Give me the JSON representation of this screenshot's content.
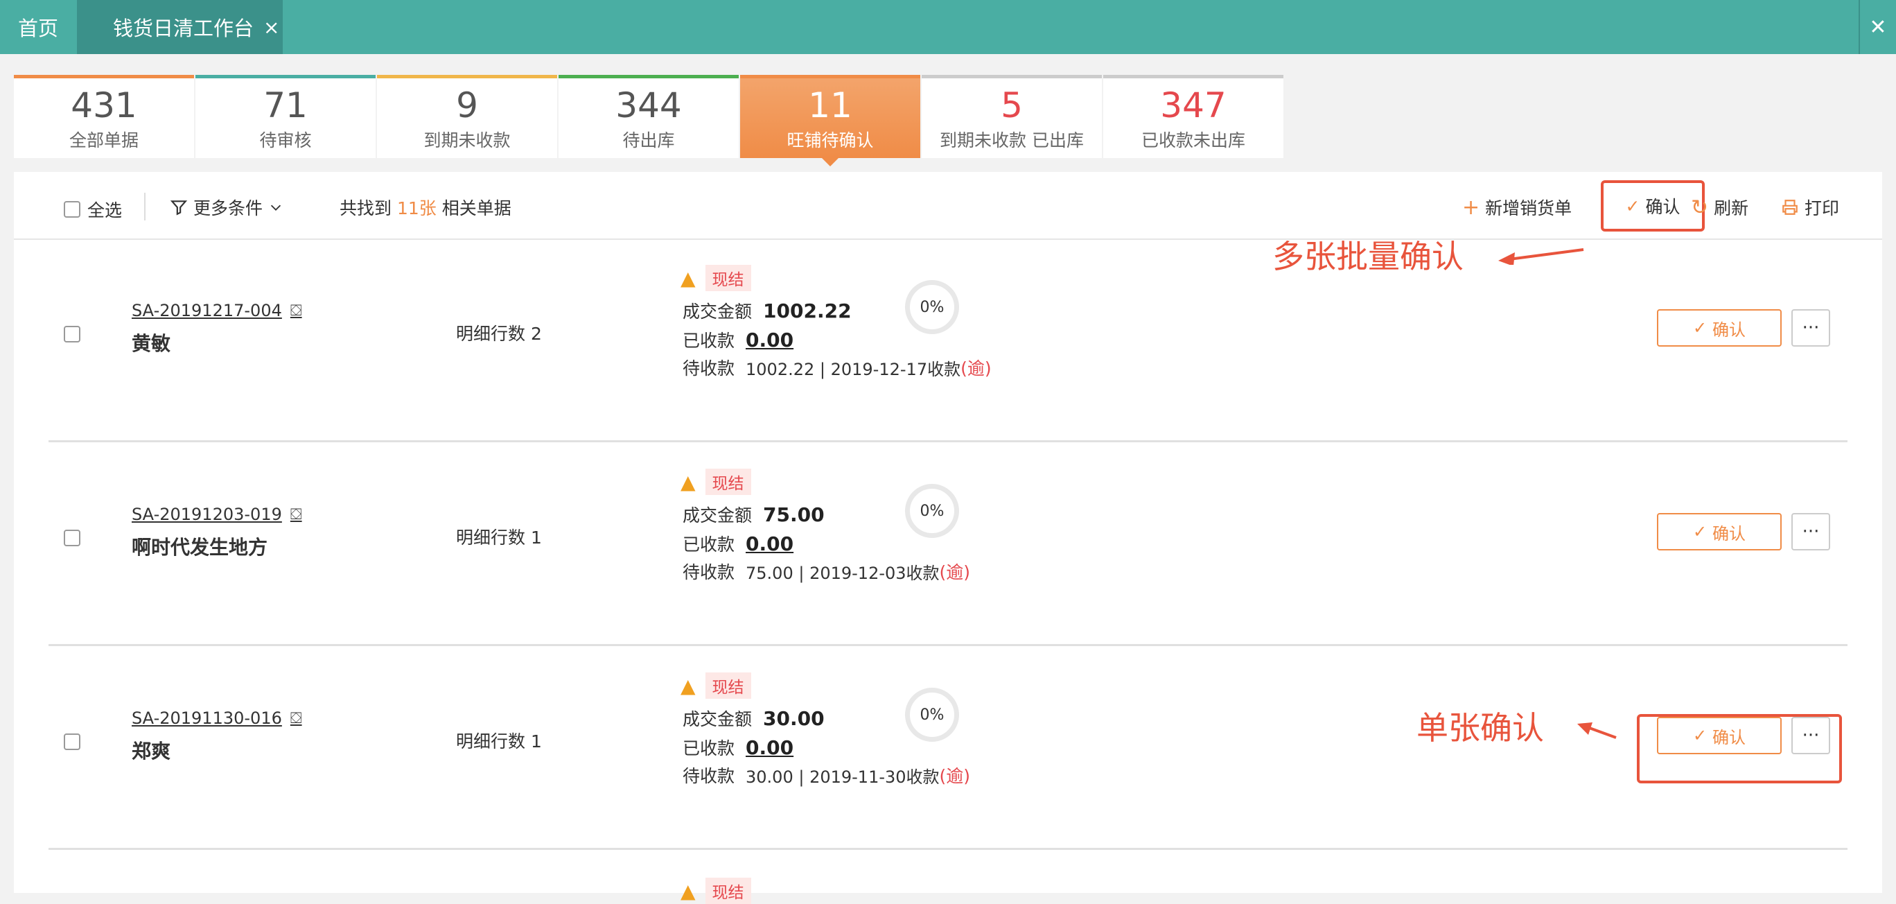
{
  "topbar": {
    "home": "首页",
    "active_tab": "钱货日清工作台",
    "tab_close": "×",
    "window_close": "✕"
  },
  "stats": [
    {
      "num": "431",
      "label": "全部单据",
      "color": "#f08c47"
    },
    {
      "num": "71",
      "label": "待审核",
      "color": "#4aaea3"
    },
    {
      "num": "9",
      "label": "到期未收款",
      "color": "#f0b64a"
    },
    {
      "num": "344",
      "label": "待出库",
      "color": "#4caf50"
    },
    {
      "num": "11",
      "label": "旺铺待确认",
      "color": "#f08c47"
    },
    {
      "num": "5",
      "label": "到期未收款 已出库",
      "color": "#cccccc"
    },
    {
      "num": "347",
      "label": "已收款未出库",
      "color": "#cccccc"
    }
  ],
  "toolbar": {
    "select_all": "全选",
    "more_filters": "更多条件",
    "found_prefix": "共找到",
    "found_count": "11张",
    "found_suffix": "相关单据",
    "add_sale": "新增销货单",
    "confirm": "确认",
    "refresh": "刷新",
    "print": "打印"
  },
  "labels": {
    "cash": "现结",
    "deal_amount": "成交金额",
    "received": "已收款",
    "pending": "待收款",
    "line_count": "明细行数",
    "overdue": "(逾)",
    "confirm": "确认",
    "more": "···"
  },
  "orders": [
    {
      "code": "SA-20191217-004",
      "customer": "黄敏",
      "lines": "2",
      "amount": "1002.22",
      "received": "0.00",
      "pending": "1002.22 | 2019-12-17收款",
      "progress": "0%"
    },
    {
      "code": "SA-20191203-019",
      "customer": "啊时代发生地方",
      "lines": "1",
      "amount": "75.00",
      "received": "0.00",
      "pending": "75.00 | 2019-12-03收款",
      "progress": "0%"
    },
    {
      "code": "SA-20191130-016",
      "customer": "郑爽",
      "lines": "1",
      "amount": "30.00",
      "received": "0.00",
      "pending": "30.00 | 2019-11-30收款",
      "progress": "0%"
    }
  ],
  "annotations": {
    "batch": "多张批量确认",
    "single": "单张确认"
  },
  "colors": {
    "accent": "#f08c47",
    "header": "#4aaea3",
    "alert": "#e5484d",
    "annotation": "#e8543c"
  }
}
